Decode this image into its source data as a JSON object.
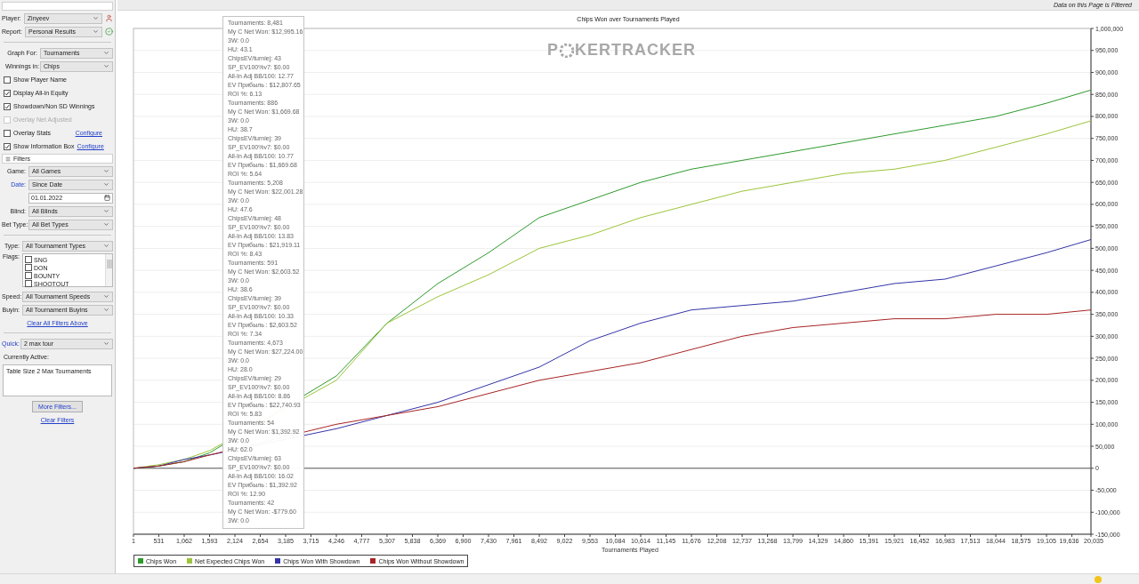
{
  "header": {
    "notice": "Data on this Page is Filtered"
  },
  "sidebar": {
    "top_fields": [
      {
        "label": "Player:",
        "value": "Zinyeev",
        "kind": "player"
      },
      {
        "label": "Report:",
        "value": "Personal Results",
        "kind": "report"
      }
    ],
    "graph_fields": [
      {
        "label": "Graph For:",
        "value": "Tournaments"
      },
      {
        "label": "Winnings in:",
        "value": "Chips"
      }
    ],
    "options": [
      {
        "label": "Show Player Name",
        "checked": false,
        "disabled": false
      },
      {
        "label": "Display All-in Equity",
        "checked": true,
        "disabled": false
      },
      {
        "label": "Showdown/Non SD Winnings",
        "checked": true,
        "disabled": false
      },
      {
        "label": "Overlay Net Adjusted",
        "checked": false,
        "disabled": true
      },
      {
        "label": "Overlay Stats",
        "checked": false,
        "disabled": false,
        "link": "Configure"
      },
      {
        "label": "Show Information Box",
        "checked": true,
        "disabled": false,
        "link": "Configure"
      }
    ],
    "filters_title": "Filters",
    "groups": [
      [
        {
          "kind": "select",
          "label": "Game:",
          "value": "All Games",
          "label_link": false
        },
        {
          "kind": "select",
          "label": "Date:",
          "value": "Since Date",
          "label_link": true
        },
        {
          "kind": "date",
          "value": "01.01.2022"
        },
        {
          "kind": "select",
          "label": "Blind:",
          "value": "All Blinds",
          "label_link": false
        },
        {
          "kind": "select",
          "label": "Bet Type:",
          "value": "All Bet Types",
          "label_link": false
        }
      ],
      [
        {
          "kind": "select",
          "label": "Type:",
          "value": "All Tournament Types",
          "label_link": false
        },
        {
          "kind": "flags",
          "label": "Flags:",
          "items": [
            {
              "label": "SNG",
              "checked": false
            },
            {
              "label": "DON",
              "checked": false
            },
            {
              "label": "BOUNTY",
              "checked": false
            },
            {
              "label": "SHOOTOUT",
              "checked": false
            }
          ]
        },
        {
          "kind": "select",
          "label": "Speed:",
          "value": "All Tournament Speeds",
          "label_link": false
        },
        {
          "kind": "select",
          "label": "Buyin:",
          "value": "All Tournament Buyins",
          "label_link": false
        },
        {
          "kind": "link",
          "text": "Clear All Filters Above"
        }
      ],
      [
        {
          "kind": "select",
          "label": "Quick:",
          "value": "2 max tour",
          "label_link": true
        },
        {
          "kind": "caption",
          "text": "Currently Active:"
        },
        {
          "kind": "textarea",
          "value": "Table Size 2 Max Tournaments"
        },
        {
          "kind": "button",
          "text": "More Filters..."
        },
        {
          "kind": "link",
          "text": "Clear Filters"
        }
      ]
    ]
  },
  "logo": {
    "before": "P",
    "after": "KERTRACKER"
  },
  "chart_data": {
    "type": "line",
    "title": "Chips Won over Tournaments Played",
    "xlabel": "Tournaments Played",
    "x": [
      1,
      531,
      1062,
      1593,
      4246,
      5307,
      6369,
      7430,
      8492,
      9553,
      10614,
      11676,
      12737,
      13799,
      14860,
      15921,
      16983,
      18044,
      19105,
      20035
    ],
    "series": [
      {
        "name": "Chips Won",
        "color": "#2e9a2e",
        "values": [
          0,
          5000,
          15000,
          35000,
          210000,
          330000,
          420000,
          490000,
          570000,
          610000,
          650000,
          680000,
          700000,
          720000,
          740000,
          760000,
          780000,
          800000,
          830000,
          860000
        ]
      },
      {
        "name": "Net Expected Chips Won",
        "color": "#9cc43a",
        "values": [
          0,
          8000,
          20000,
          40000,
          200000,
          330000,
          390000,
          440000,
          500000,
          530000,
          570000,
          600000,
          630000,
          650000,
          670000,
          680000,
          700000,
          730000,
          760000,
          790000
        ]
      },
      {
        "name": "Chips Won With Showdown",
        "color": "#3434a8",
        "values": [
          0,
          5000,
          20000,
          30000,
          90000,
          120000,
          150000,
          190000,
          230000,
          290000,
          330000,
          360000,
          370000,
          380000,
          400000,
          420000,
          430000,
          460000,
          490000,
          520000
        ]
      },
      {
        "name": "Chips Won Without Showdown",
        "color": "#a82424",
        "values": [
          0,
          5000,
          15000,
          30000,
          100000,
          120000,
          140000,
          170000,
          200000,
          220000,
          240000,
          270000,
          300000,
          320000,
          330000,
          340000,
          340000,
          350000,
          350000,
          360000
        ]
      }
    ],
    "xlim": [
      1,
      20035
    ],
    "ylim": [
      -150000,
      1000000
    ],
    "grid": true,
    "xticks": [
      1,
      531,
      {
        "value": 1062,
        "label": "1,062"
      },
      {
        "value": 1593,
        "label": "1,593"
      },
      {
        "value": 2124,
        "label": "2,124"
      },
      {
        "value": 2654,
        "label": "2,654"
      },
      {
        "value": 3185,
        "label": "3,185"
      },
      {
        "value": 3715,
        "label": "3,715"
      },
      {
        "value": 4246,
        "label": "4,246"
      },
      {
        "value": 4777,
        "label": "4,777"
      },
      {
        "value": 5307,
        "label": "5,307"
      },
      {
        "value": 5838,
        "label": "5,838"
      },
      {
        "value": 6369,
        "label": "6,369"
      },
      {
        "value": 6900,
        "label": "6,900"
      },
      {
        "value": 7430,
        "label": "7,430"
      },
      {
        "value": 7961,
        "label": "7,961"
      },
      {
        "value": 8492,
        "label": "8,492"
      },
      {
        "value": 9022,
        "label": "9,022"
      },
      {
        "value": 9553,
        "label": "9,553"
      },
      {
        "value": 10084,
        "label": "10,084"
      },
      {
        "value": 10614,
        "label": "10,614"
      },
      {
        "value": 11145,
        "label": "11,145"
      },
      {
        "value": 11676,
        "label": "11,676"
      },
      {
        "value": 12208,
        "label": "12,208"
      },
      {
        "value": 12737,
        "label": "12,737"
      },
      {
        "value": 13268,
        "label": "13,268"
      },
      {
        "value": 13799,
        "label": "13,799"
      },
      {
        "value": 14329,
        "label": "14,329"
      },
      {
        "value": 14860,
        "label": "14,860"
      },
      {
        "value": 15391,
        "label": "15,391"
      },
      {
        "value": 15921,
        "label": "15,921"
      },
      {
        "value": 16452,
        "label": "16,452"
      },
      {
        "value": 16983,
        "label": "16,983"
      },
      {
        "value": 17513,
        "label": "17,513"
      },
      {
        "value": 18044,
        "label": "18,044"
      },
      {
        "value": 18575,
        "label": "18,575"
      },
      {
        "value": 19105,
        "label": "19,105"
      },
      {
        "value": 19636,
        "label": "19,636"
      },
      {
        "value": 20035,
        "label": "20,035"
      }
    ],
    "yticks": [
      {
        "value": -150000,
        "label": "-150,000"
      },
      {
        "value": -100000,
        "label": "-100,000"
      },
      {
        "value": -50000,
        "label": "-50,000"
      },
      0,
      {
        "value": 50000,
        "label": "50,000"
      },
      {
        "value": 100000,
        "label": "100,000"
      },
      {
        "value": 150000,
        "label": "150,000"
      },
      {
        "value": 200000,
        "label": "200,000"
      },
      {
        "value": 250000,
        "label": "250,000"
      },
      {
        "value": 300000,
        "label": "300,000"
      },
      {
        "value": 350000,
        "label": "350,000"
      },
      {
        "value": 400000,
        "label": "400,000"
      },
      {
        "value": 450000,
        "label": "450,000"
      },
      {
        "value": 500000,
        "label": "500,000"
      },
      {
        "value": 550000,
        "label": "550,000"
      },
      {
        "value": 600000,
        "label": "600,000"
      },
      {
        "value": 650000,
        "label": "650,000"
      },
      {
        "value": 700000,
        "label": "700,000"
      },
      {
        "value": 750000,
        "label": "750,000"
      },
      {
        "value": 800000,
        "label": "800,000"
      },
      {
        "value": 850000,
        "label": "850,000"
      },
      {
        "value": 900000,
        "label": "900,000"
      },
      {
        "value": 950000,
        "label": "950,000"
      },
      {
        "value": 1000000,
        "label": "1,000,000"
      }
    ]
  },
  "info_box": {
    "lines": [
      "Tournaments: 8,481",
      "My C Net Won: $12,995.16",
      "3W: 0.0",
      "HU: 43.1",
      "ChipsEV/turniej: 43",
      "SP_EV100%v7: $0.00",
      "All-In Adj BB/100: 12.77",
      "EV Прибыль : $12,807.65",
      "ROI %: 6.13",
      "Tournaments: 886",
      "My C Net Won: $1,669.68",
      "3W: 0.0",
      "HU: 38.7",
      "ChipsEV/turniej: 39",
      "SP_EV100%v7: $0.00",
      "All-In Adj BB/100: 10.77",
      "EV Прибыль : $1,669.68",
      "ROI %: 5.64",
      "Tournaments: 5,208",
      "My C Net Won: $22,001.28",
      "3W: 0.0",
      "HU: 47.6",
      "ChipsEV/turniej: 48",
      "SP_EV100%v7: $0.00",
      "All-In Adj BB/100: 13.83",
      "EV Прибыль : $21,919.11",
      "ROI %: 8.43",
      "Tournaments: 591",
      "My C Net Won: $2,603.52",
      "3W: 0.0",
      "HU: 38.6",
      "ChipsEV/turniej: 39",
      "SP_EV100%v7: $0.00",
      "All-In Adj BB/100: 10.33",
      "EV Прибыль : $2,603.52",
      "ROI %: 7.34",
      "Tournaments: 4,673",
      "My C Net Won: $27,224.00",
      "3W: 0.0",
      "HU: 28.0",
      "ChipsEV/turniej: 29",
      "SP_EV100%v7: $0.00",
      "All-In Adj BB/100: 8.86",
      "EV Прибыль : $22,740.93",
      "ROI %: 5.83",
      "Tournaments: 54",
      "My C Net Won: $1,392.92",
      "3W: 0.0",
      "HU: 62.0",
      "ChipsEV/turniej: 63",
      "SP_EV100%v7: $0.00",
      "All-In Adj BB/100: 16.02",
      "EV Прибыль : $1,392.92",
      "ROI %: 12.90",
      "Tournaments: 42",
      "My C Net Won: -$779.60",
      "3W: 0.0"
    ]
  }
}
